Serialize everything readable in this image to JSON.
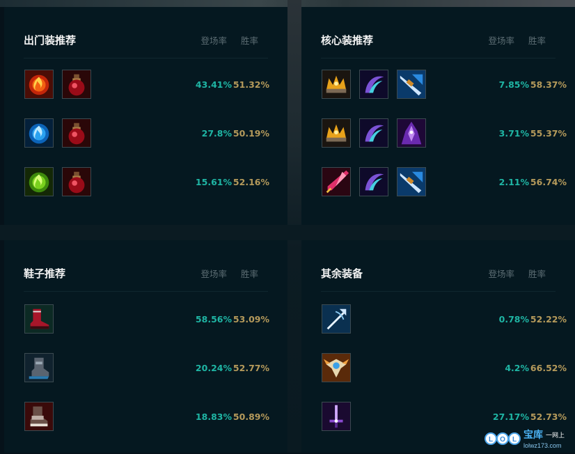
{
  "col_rate_label": "登场率",
  "col_win_label": "胜率",
  "colors": {
    "rate": "#1fb5a4",
    "win": "#b59a5b",
    "panel": "#051820",
    "title": "#f2f2f2"
  },
  "panels": [
    {
      "title": "出门装推荐",
      "rows": [
        {
          "items": [
            "fire-orb-icon",
            "health-potion-icon"
          ],
          "rate": "43.41%",
          "win": "51.32%"
        },
        {
          "items": [
            "ice-orb-icon",
            "health-potion-icon"
          ],
          "rate": "27.8%",
          "win": "50.19%"
        },
        {
          "items": [
            "nature-orb-icon",
            "health-potion-icon"
          ],
          "rate": "15.61%",
          "win": "52.16%"
        }
      ]
    },
    {
      "title": "核心装推荐",
      "rows": [
        {
          "items": [
            "golden-crown-icon",
            "void-scythe-icon",
            "blue-blade-icon"
          ],
          "rate": "7.85%",
          "win": "58.37%"
        },
        {
          "items": [
            "golden-crown-icon",
            "void-scythe-icon",
            "purple-demon-icon"
          ],
          "rate": "3.71%",
          "win": "55.37%"
        },
        {
          "items": [
            "crimson-blade-icon",
            "void-scythe-icon",
            "blue-blade-icon"
          ],
          "rate": "2.11%",
          "win": "56.74%"
        }
      ]
    },
    {
      "title": "鞋子推荐",
      "rows": [
        {
          "items": [
            "red-boots-icon"
          ],
          "rate": "58.56%",
          "win": "53.09%"
        },
        {
          "items": [
            "steel-boots-icon"
          ],
          "rate": "20.24%",
          "win": "52.77%"
        },
        {
          "items": [
            "armored-boots-icon"
          ],
          "rate": "18.83%",
          "win": "50.89%"
        }
      ]
    },
    {
      "title": "其余装备",
      "rows": [
        {
          "items": [
            "silver-trident-icon"
          ],
          "rate": "0.78%",
          "win": "52.22%"
        },
        {
          "items": [
            "winged-crest-icon"
          ],
          "rate": "4.2%",
          "win": "66.52%"
        },
        {
          "items": [
            "violet-sword-icon"
          ],
          "rate": "27.17%",
          "win": "52.73%"
        }
      ]
    }
  ],
  "watermark": {
    "badge": "LOL",
    "brand": "宝库",
    "slogan": "一网上",
    "url": "lolwz173.com"
  }
}
